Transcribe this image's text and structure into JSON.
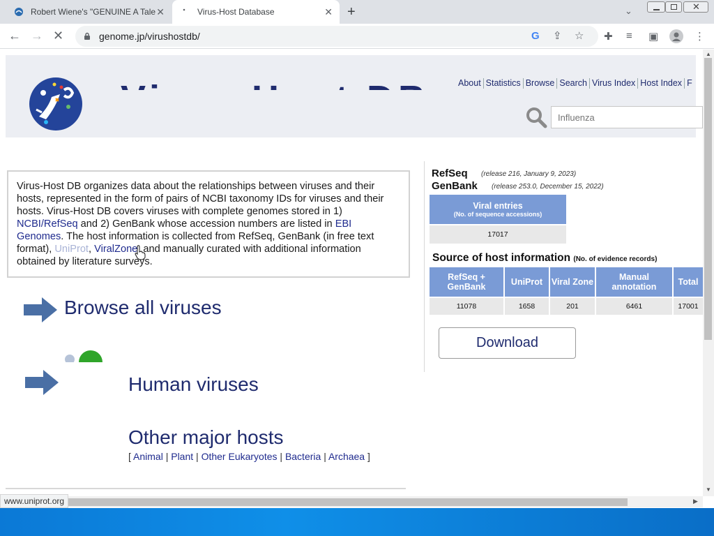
{
  "browser": {
    "tabs": [
      {
        "title": "Robert Wiene's \"GENUINE A Tale",
        "active": false
      },
      {
        "title": "Virus-Host Database",
        "active": true
      }
    ],
    "url": "genome.jp/virushostdb/",
    "status_text": "www.uniprot.org"
  },
  "header": {
    "title_fragment": "Virus-Host DB",
    "nav": [
      "About",
      "Statistics",
      "Browse",
      "Search",
      "Virus Index",
      "Host Index",
      "F"
    ],
    "search_placeholder": "Influenza"
  },
  "intro": {
    "text_1": "Virus-Host DB organizes data about the relationships between viruses and their hosts, represented in the form of pairs of NCBI taxonomy IDs for viruses and their hosts. Virus-Host DB covers viruses with complete genomes stored in 1) ",
    "link_ncbi": "NCBI/RefSeq",
    "text_2": " and 2) GenBank whose accession numbers are listed in ",
    "link_ebi": "EBI Genomes",
    "text_3": ". The host information is collected from RefSeq, GenBank (in free text format), ",
    "link_uniprot": "UniProt",
    "text_4": ", ",
    "link_viralzone": "ViralZone",
    "text_5": ", and manually curated with additional information obtained by literature surveys."
  },
  "sections": {
    "browse_all": "Browse all viruses",
    "human": "Human viruses",
    "other_hosts": "Other major hosts",
    "host_links": [
      "Animal",
      "Plant",
      "Other Eukaryotes",
      "Bacteria",
      "Archaea"
    ],
    "bracket_open": "[",
    "bracket_close": "]",
    "sep": "|"
  },
  "release": {
    "refseq_name": "RefSeq",
    "refseq_note": "(release 216, January 9, 2023)",
    "genbank_name": "GenBank",
    "genbank_note": "(release 253.0, December 15, 2022)",
    "viral_entries_label": "Viral entries",
    "viral_entries_sub": "(No. of sequence accessions)",
    "viral_entries_value": "17017"
  },
  "source": {
    "title": "Source of host information",
    "subtitle": "(No. of evidence records)",
    "columns": [
      "RefSeq + GenBank",
      "UniProt",
      "Viral Zone",
      "Manual annotation",
      "Total"
    ],
    "values": [
      "11078",
      "1658",
      "201",
      "6461",
      "17001"
    ]
  },
  "download_label": "Download",
  "colors": {
    "accent": "#1f2b6e",
    "table_header": "#7a9bd6",
    "table_cell": "#e8e8e8"
  }
}
